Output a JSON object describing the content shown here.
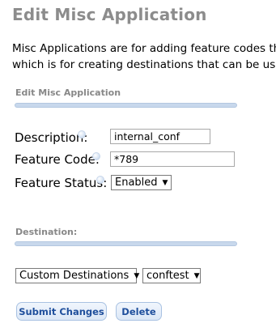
{
  "page": {
    "title": "Edit Misc Application",
    "intro_line1": "Misc Applications are for adding feature codes that",
    "intro_line2": "which is for creating destinations that can be used b"
  },
  "section_edit": {
    "heading": "Edit Misc Application"
  },
  "form": {
    "description_label": "Description:",
    "description_value": "internal_conf",
    "feature_code_label": "Feature Code:",
    "feature_code_value": "*789",
    "feature_status_label": "Feature Status:",
    "feature_status_value": "Enabled"
  },
  "section_destination": {
    "heading": "Destination:"
  },
  "destination": {
    "type_value": "Custom Destinations",
    "target_value": "conftest"
  },
  "buttons": {
    "submit_label": "Submit Changes",
    "delete_label": "Delete"
  },
  "icons": {
    "help": "help-bubble-icon",
    "dropdown": "chevron-down-icon"
  },
  "colors": {
    "title": "#8c8c8c",
    "section_bar": "#c8d8ec",
    "button_text": "#1f4f9c"
  }
}
